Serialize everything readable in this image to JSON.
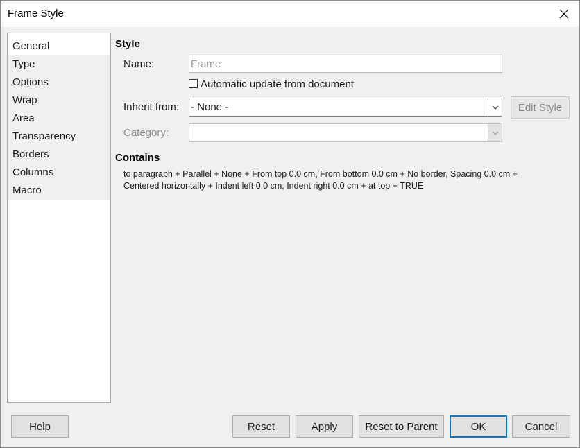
{
  "window": {
    "title": "Frame Style"
  },
  "sidebar": {
    "items": [
      {
        "label": "General"
      },
      {
        "label": "Type"
      },
      {
        "label": "Options"
      },
      {
        "label": "Wrap"
      },
      {
        "label": "Area"
      },
      {
        "label": "Transparency"
      },
      {
        "label": "Borders"
      },
      {
        "label": "Columns"
      },
      {
        "label": "Macro"
      }
    ],
    "active": "General"
  },
  "style_section": {
    "heading": "Style",
    "name_label": "Name:",
    "name_value": "Frame",
    "auto_update_label": "Automatic update from document",
    "auto_update_checked": false,
    "inherit_label": "Inherit from:",
    "inherit_value": "- None -",
    "edit_style_label": "Edit Style",
    "category_label": "Category:",
    "category_value": ""
  },
  "contains_section": {
    "heading": "Contains",
    "line1": "to paragraph + Parallel + None + From top 0.0 cm, From bottom 0.0 cm + No border, Spacing 0.0 cm +",
    "line2": "Centered horizontally + Indent left 0.0 cm, Indent right 0.0 cm + at top + TRUE"
  },
  "footer": {
    "help": "Help",
    "reset": "Reset",
    "apply": "Apply",
    "reset_to_parent": "Reset to Parent",
    "ok": "OK",
    "cancel": "Cancel"
  },
  "icons": {
    "close": "close-icon",
    "dropdown": "chevron-down-icon"
  }
}
